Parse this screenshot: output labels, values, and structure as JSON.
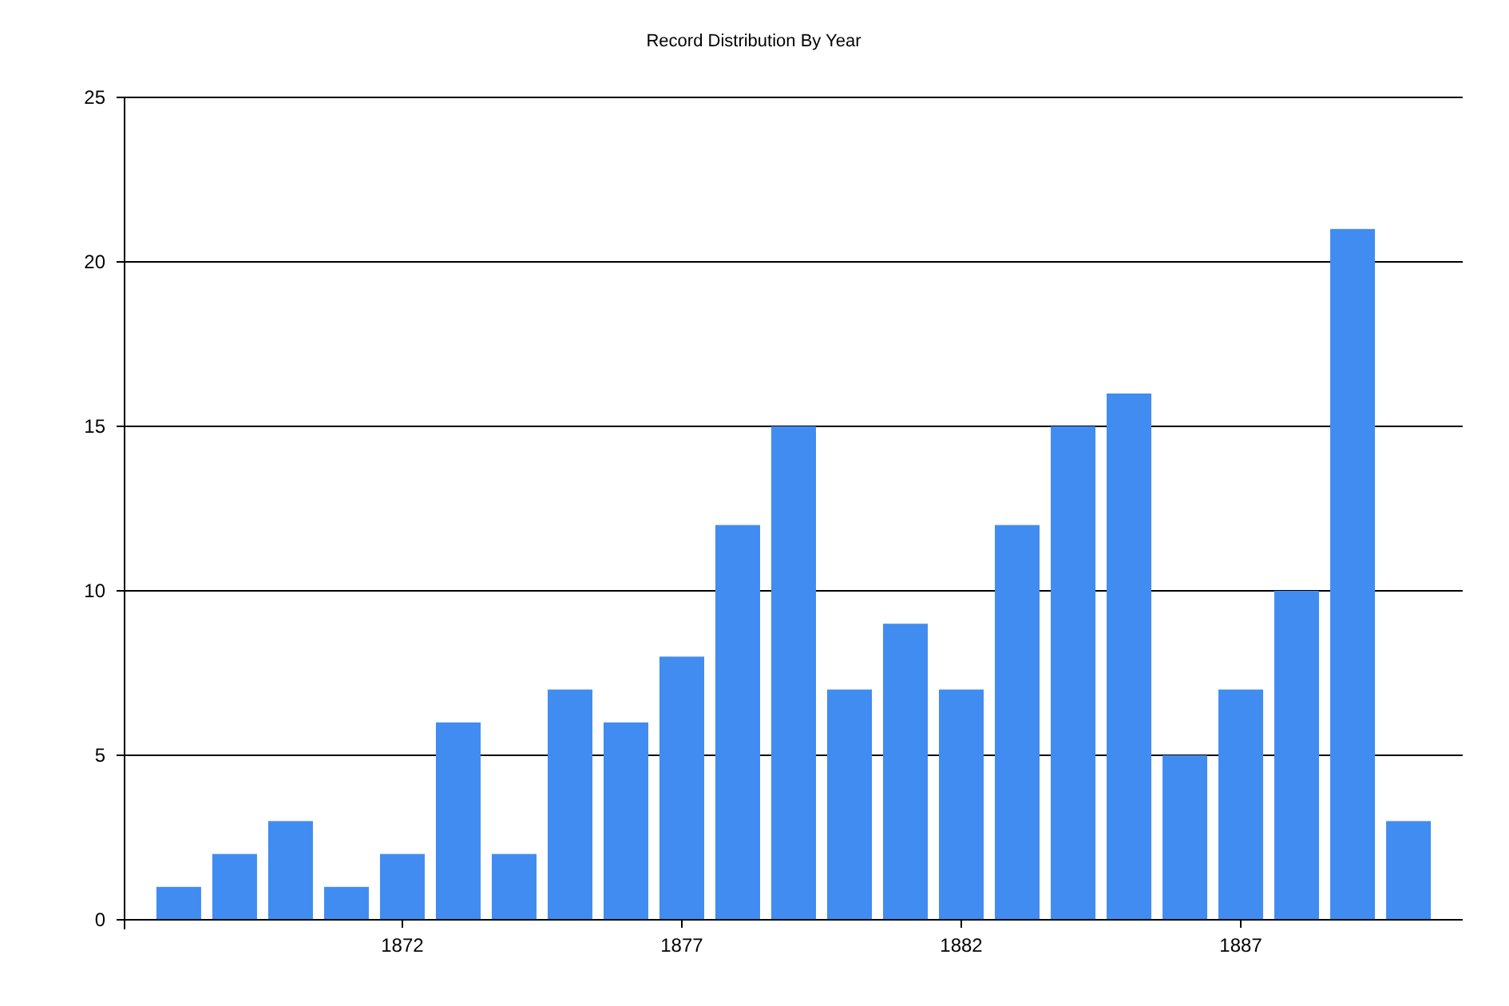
{
  "chart_data": {
    "type": "bar",
    "title": "Record Distribution By Year",
    "x": [
      1868,
      1869,
      1870,
      1871,
      1872,
      1873,
      1874,
      1875,
      1876,
      1877,
      1878,
      1879,
      1880,
      1881,
      1882,
      1883,
      1884,
      1885,
      1886,
      1887,
      1888,
      1889,
      1890
    ],
    "grid": true,
    "series": [
      {
        "color": "#418cf0",
        "values": [
          1,
          2,
          3,
          1,
          2,
          6,
          2,
          7,
          6,
          8,
          12,
          15,
          7,
          9,
          7,
          12,
          15,
          16,
          5,
          7,
          10,
          21,
          3
        ]
      }
    ],
    "xlim": [
      1867.03,
      1890.97
    ],
    "ylim": [
      0,
      25
    ],
    "xticks": [
      1872,
      1877,
      1882,
      1887
    ],
    "yticks": [
      0,
      5,
      10,
      15,
      20,
      25
    ]
  }
}
